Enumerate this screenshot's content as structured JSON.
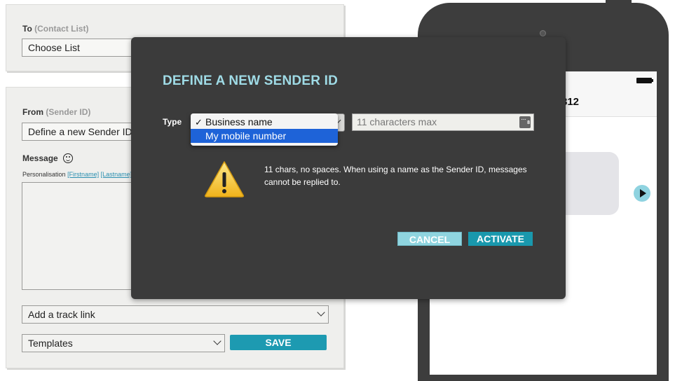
{
  "to_panel": {
    "label": "To",
    "label_hint": "(Contact List)",
    "list_select": "Choose List"
  },
  "from_panel": {
    "label": "From",
    "label_hint": "(Sender ID)",
    "sender_select": "Define a new Sender ID",
    "message_label": "Message",
    "personalisation_label": "Personalisation",
    "personalisation_firstname": "[Firstname]",
    "personalisation_lastname": "[Lastname]",
    "track_link_select": "Add a track link",
    "templates_select": "Templates",
    "save_label": "SAVE"
  },
  "phone": {
    "header_number": "312"
  },
  "modal": {
    "title": "DEFINE A NEW SENDER ID",
    "type_label": "Type",
    "type_options": [
      "Business name",
      "My mobile number"
    ],
    "type_selected": "Business name",
    "type_highlighted": "My mobile number",
    "sender_placeholder": "11 characters max",
    "warning_text": "11 chars, no spaces. When using a name as the Sender ID, messages cannot be replied to.",
    "cancel_label": "CANCEL",
    "activate_label": "ACTIVATE"
  },
  "colors": {
    "accent": "#1998ad",
    "accent_light": "#8fd4df",
    "modal_bg": "#3b3b3b",
    "title_color": "#9fdbe6",
    "highlight": "#1e63d8"
  }
}
